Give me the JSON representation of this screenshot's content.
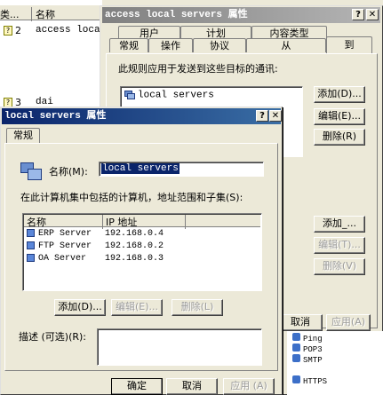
{
  "background_list": {
    "header_cols": [
      "类...",
      "名称"
    ],
    "rows": [
      {
        "num": "2",
        "name": "access local se"
      },
      {
        "num": "3",
        "name": "dai"
      }
    ]
  },
  "access_dialog": {
    "title": "access local servers 属性",
    "tabs_row1": [
      "用户",
      "计划",
      "内容类型"
    ],
    "tabs_row2": [
      "常规",
      "操作",
      "协议",
      "从",
      "到"
    ],
    "intro": "此规则应用于发送到这些目标的通讯:",
    "dest_item": "local servers",
    "add_label": "添加(D)...",
    "edit_label": "编辑(E)...",
    "delete_label": "删除(R)",
    "add2_label": "添加_...",
    "edit2_label": "编辑(T)...",
    "delete2_label": "删除(V)",
    "cancel_label": "取消",
    "apply_label": "应用(A)",
    "protocols": [
      "Ping",
      "POP3",
      "SMTP",
      "HTTPS"
    ]
  },
  "local_dialog": {
    "title": "local servers 属性",
    "tab": "常规",
    "name_label": "名称(M):",
    "name_value": "local servers",
    "section_label": "在此计算机集中包括的计算机，地址范围和子集(S):",
    "columns": [
      "名称",
      "IP 地址"
    ],
    "computers": [
      {
        "name": "ERP Server",
        "ip": "192.168.0.4"
      },
      {
        "name": "FTP Server",
        "ip": "192.168.0.2"
      },
      {
        "name": "OA Server",
        "ip": "192.168.0.3"
      }
    ],
    "add_label": "添加(D)...",
    "edit_label": "编辑(E)...",
    "delete_label": "删除(L)",
    "desc_label": "描述 (可选)(R):",
    "desc_value": "",
    "ok_label": "确定",
    "cancel_label": "取消",
    "apply_label": "应用 (A)"
  },
  "colors": {
    "title_active": "#0a246a",
    "title_inactive": "#808080",
    "selection": "#0a246a"
  }
}
